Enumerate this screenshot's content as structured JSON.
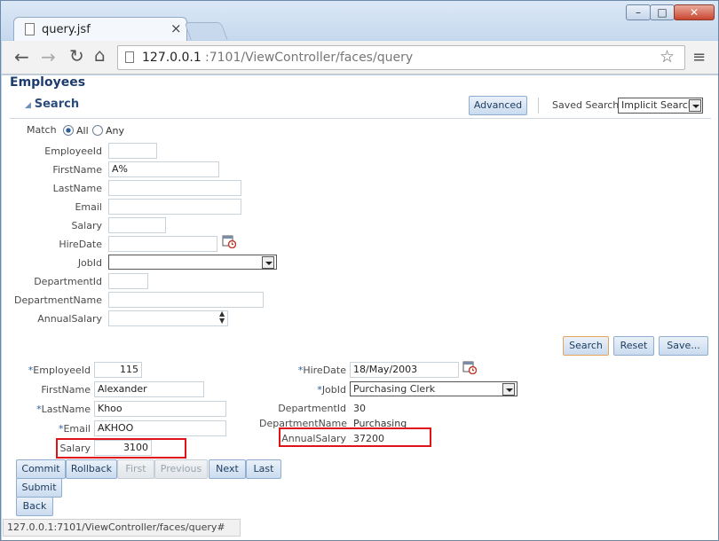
{
  "browser": {
    "tab_title": "query.jsf",
    "tab_close": "×",
    "url_host": "127.0.0.1",
    "url_rest": ":7101/ViewController/faces/query",
    "status_url": "127.0.0.1:7101/ViewController/faces/query#",
    "window_buttons": {
      "minimize": "–",
      "maximize": "□",
      "close": "✕"
    }
  },
  "page": {
    "title": "Employees",
    "search_header": "Search",
    "advanced_button": "Advanced",
    "saved_search_label": "Saved Search",
    "saved_search_value": "Implicit Search",
    "match_label": "Match",
    "match_all": "All",
    "match_any": "Any"
  },
  "query_fields": {
    "employee_id": {
      "label": "EmployeeId",
      "value": ""
    },
    "first_name": {
      "label": "FirstName",
      "value": "A%"
    },
    "last_name": {
      "label": "LastName",
      "value": ""
    },
    "email": {
      "label": "Email",
      "value": ""
    },
    "salary": {
      "label": "Salary",
      "value": ""
    },
    "hire_date": {
      "label": "HireDate",
      "value": ""
    },
    "job_id": {
      "label": "JobId",
      "value": ""
    },
    "department_id": {
      "label": "DepartmentId",
      "value": ""
    },
    "department_name": {
      "label": "DepartmentName",
      "value": ""
    },
    "annual_salary": {
      "label": "AnnualSalary",
      "value": ""
    }
  },
  "search_buttons": {
    "search": "Search",
    "reset": "Reset",
    "save": "Save..."
  },
  "form": {
    "required_marker": "*",
    "employee_id": {
      "label": "EmployeeId",
      "value": "115"
    },
    "first_name": {
      "label": "FirstName",
      "value": "Alexander"
    },
    "last_name": {
      "label": "LastName",
      "value": "Khoo"
    },
    "email": {
      "label": "Email",
      "value": "AKHOO"
    },
    "salary": {
      "label": "Salary",
      "value": "3100"
    },
    "hire_date": {
      "label": "HireDate",
      "value": "18/May/2003"
    },
    "job_id": {
      "label": "JobId",
      "value": "Purchasing Clerk"
    },
    "department_id": {
      "label": "DepartmentId",
      "value": "30"
    },
    "department_name": {
      "label": "DepartmentName",
      "value": "Purchasing"
    },
    "annual_salary": {
      "label": "AnnualSalary",
      "value": "37200"
    }
  },
  "nav_buttons": {
    "commit": "Commit",
    "rollback": "Rollback",
    "first": "First",
    "previous": "Previous",
    "next": "Next",
    "last": "Last",
    "submit": "Submit",
    "back": "Back"
  },
  "colors": {
    "highlight_box": "#e0121a",
    "title": "#1d3c6e"
  }
}
